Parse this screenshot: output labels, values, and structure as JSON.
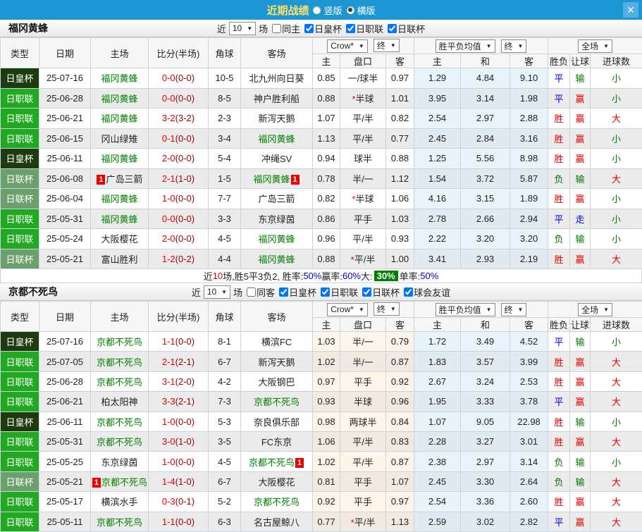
{
  "topbar": {
    "title": "近期战绩",
    "close_glyph": "✕",
    "radios": [
      {
        "label": "竖版",
        "selected": false
      },
      {
        "label": "横版",
        "selected": true
      }
    ]
  },
  "colors": {
    "topbar": "#1d96d4",
    "close_button": "#54aee3",
    "title_text": "#ffe26a",
    "score": "#e60000",
    "halftime": "#990000",
    "focus_team": "#008000",
    "league": {
      "日皇杯": "#1d3b0e",
      "日职联": "#22a922",
      "日联杯": "#6b9f6b"
    },
    "win_red": "#e60000",
    "draw_blue": "#0000e6",
    "lose_green": "#007700",
    "percent_blue": "#0000cc",
    "big_badge_bg": "#008000"
  },
  "columns": [
    "类型",
    "日期",
    "主场",
    "比分(半场)",
    "角球",
    "客场",
    "主",
    "盘口",
    "客",
    "主",
    "和",
    "客",
    "胜负",
    "让球",
    "进球数"
  ],
  "header": {
    "odds_source": "Crow*",
    "final": "终",
    "avg_label": "胜平负均值",
    "scope": "全场",
    "caret": "▼"
  },
  "sections": [
    {
      "team": "福冈黄蜂",
      "filter": {
        "near_label": "近",
        "count": "10",
        "games_label": "场",
        "same_label": "同主",
        "same_checked": false,
        "leagues": [
          {
            "label": "日皇杯",
            "checked": true
          },
          {
            "label": "日职联",
            "checked": true
          },
          {
            "label": "日联杯",
            "checked": true
          }
        ]
      },
      "odds_tint": false,
      "rows": [
        {
          "league": "日皇杯",
          "date": "25-07-16",
          "home": "福冈黄蜂",
          "hf": true,
          "hb": "",
          "score": "0-0",
          "half": "(0-0)",
          "corner": "10-5",
          "away": "北九州向日葵",
          "af": false,
          "ab": "",
          "o1": "0.85",
          "line": "一/球半",
          "star": false,
          "o2": "0.97",
          "a1": "1.29",
          "a2": "4.84",
          "a3": "9.10",
          "res": "平",
          "hcp": "输",
          "goals": "小"
        },
        {
          "league": "日职联",
          "date": "25-06-28",
          "home": "福冈黄蜂",
          "hf": true,
          "hb": "",
          "score": "0-0",
          "half": "(0-0)",
          "corner": "8-5",
          "away": "神户胜利船",
          "af": false,
          "ab": "",
          "o1": "0.88",
          "line": "半球",
          "star": true,
          "o2": "1.01",
          "a1": "3.95",
          "a2": "3.14",
          "a3": "1.98",
          "res": "平",
          "hcp": "赢",
          "goals": "小"
        },
        {
          "league": "日职联",
          "date": "25-06-21",
          "home": "福冈黄蜂",
          "hf": true,
          "hb": "",
          "score": "3-2",
          "half": "(3-2)",
          "corner": "2-3",
          "away": "新泻天鹅",
          "af": false,
          "ab": "",
          "o1": "1.07",
          "line": "平/半",
          "star": false,
          "o2": "0.82",
          "a1": "2.54",
          "a2": "2.97",
          "a3": "2.88",
          "res": "胜",
          "hcp": "赢",
          "goals": "大"
        },
        {
          "league": "日职联",
          "date": "25-06-15",
          "home": "冈山绿雉",
          "hf": false,
          "hb": "",
          "score": "0-1",
          "half": "(0-0)",
          "corner": "3-4",
          "away": "福冈黄蜂",
          "af": true,
          "ab": "",
          "o1": "1.13",
          "line": "平/半",
          "star": false,
          "o2": "0.77",
          "a1": "2.45",
          "a2": "2.84",
          "a3": "3.16",
          "res": "胜",
          "hcp": "赢",
          "goals": "小"
        },
        {
          "league": "日皇杯",
          "date": "25-06-11",
          "home": "福冈黄蜂",
          "hf": true,
          "hb": "",
          "score": "2-0",
          "half": "(0-0)",
          "corner": "5-4",
          "away": "冲绳SV",
          "af": false,
          "ab": "",
          "o1": "0.94",
          "line": "球半",
          "star": false,
          "o2": "0.88",
          "a1": "1.25",
          "a2": "5.56",
          "a3": "8.98",
          "res": "胜",
          "hcp": "赢",
          "goals": "小"
        },
        {
          "league": "日联杯",
          "date": "25-06-08",
          "home": "广岛三箭",
          "hf": false,
          "hb": "1",
          "score": "2-1",
          "half": "(1-0)",
          "corner": "1-5",
          "away": "福冈黄蜂",
          "af": true,
          "ab": "1",
          "o1": "0.78",
          "line": "半/一",
          "star": false,
          "o2": "1.12",
          "a1": "1.54",
          "a2": "3.72",
          "a3": "5.87",
          "res": "负",
          "hcp": "输",
          "goals": "大"
        },
        {
          "league": "日联杯",
          "date": "25-06-04",
          "home": "福冈黄蜂",
          "hf": true,
          "hb": "",
          "score": "1-0",
          "half": "(0-0)",
          "corner": "7-7",
          "away": "广岛三箭",
          "af": false,
          "ab": "",
          "o1": "0.82",
          "line": "半球",
          "star": true,
          "o2": "1.06",
          "a1": "4.16",
          "a2": "3.15",
          "a3": "1.89",
          "res": "胜",
          "hcp": "赢",
          "goals": "小"
        },
        {
          "league": "日职联",
          "date": "25-05-31",
          "home": "福冈黄蜂",
          "hf": true,
          "hb": "",
          "score": "0-0",
          "half": "(0-0)",
          "corner": "3-3",
          "away": "东京绿茵",
          "af": false,
          "ab": "",
          "o1": "0.86",
          "line": "平手",
          "star": false,
          "o2": "1.03",
          "a1": "2.78",
          "a2": "2.66",
          "a3": "2.94",
          "res": "平",
          "hcp": "走",
          "goals": "小"
        },
        {
          "league": "日职联",
          "date": "25-05-24",
          "home": "大阪樱花",
          "hf": false,
          "hb": "",
          "score": "2-0",
          "half": "(0-0)",
          "corner": "4-5",
          "away": "福冈黄蜂",
          "af": true,
          "ab": "",
          "o1": "0.96",
          "line": "平/半",
          "star": false,
          "o2": "0.93",
          "a1": "2.22",
          "a2": "3.20",
          "a3": "3.20",
          "res": "负",
          "hcp": "输",
          "goals": "小"
        },
        {
          "league": "日联杯",
          "date": "25-05-21",
          "home": "富山胜利",
          "hf": false,
          "hb": "",
          "score": "1-2",
          "half": "(0-2)",
          "corner": "4-4",
          "away": "福冈黄蜂",
          "af": true,
          "ab": "",
          "o1": "0.88",
          "line": "平/半",
          "star": true,
          "o2": "1.00",
          "a1": "3.41",
          "a2": "2.93",
          "a3": "2.19",
          "res": "胜",
          "hcp": "赢",
          "goals": "大"
        }
      ],
      "summary": [
        {
          "text": "近"
        },
        {
          "text": "10",
          "color": "red"
        },
        {
          "text": "场,胜5平3负2, 胜率:"
        },
        {
          "text": "50%",
          "color": "blue"
        },
        {
          "text": " 赢率:"
        },
        {
          "text": "60%",
          "color": "blue"
        },
        {
          "text": " 大: "
        },
        {
          "text": "30%",
          "color": "badge"
        },
        {
          "text": " 单率:"
        },
        {
          "text": "50%",
          "color": "blue"
        }
      ]
    },
    {
      "team": "京都不死鸟",
      "filter": {
        "near_label": "近",
        "count": "10",
        "games_label": "场",
        "same_label": "同客",
        "same_checked": false,
        "leagues": [
          {
            "label": "日皇杯",
            "checked": true
          },
          {
            "label": "日职联",
            "checked": true
          },
          {
            "label": "日联杯",
            "checked": true
          },
          {
            "label": "球会友谊",
            "checked": true
          }
        ]
      },
      "odds_tint": true,
      "rows": [
        {
          "league": "日皇杯",
          "date": "25-07-16",
          "home": "京都不死鸟",
          "hf": true,
          "hb": "",
          "score": "1-1",
          "half": "(0-0)",
          "corner": "8-1",
          "away": "横滨FC",
          "af": false,
          "ab": "",
          "o1": "1.03",
          "line": "半/一",
          "star": false,
          "o2": "0.79",
          "a1": "1.72",
          "a2": "3.49",
          "a3": "4.52",
          "res": "平",
          "hcp": "输",
          "goals": "小"
        },
        {
          "league": "日职联",
          "date": "25-07-05",
          "home": "京都不死鸟",
          "hf": true,
          "hb": "",
          "score": "2-1",
          "half": "(2-1)",
          "corner": "6-7",
          "away": "新泻天鹅",
          "af": false,
          "ab": "",
          "o1": "1.02",
          "line": "半/一",
          "star": false,
          "o2": "0.87",
          "a1": "1.83",
          "a2": "3.57",
          "a3": "3.99",
          "res": "胜",
          "hcp": "赢",
          "goals": "大"
        },
        {
          "league": "日职联",
          "date": "25-06-28",
          "home": "京都不死鸟",
          "hf": true,
          "hb": "",
          "score": "3-1",
          "half": "(2-0)",
          "corner": "4-2",
          "away": "大阪钢巴",
          "af": false,
          "ab": "",
          "o1": "0.97",
          "line": "平手",
          "star": false,
          "o2": "0.92",
          "a1": "2.67",
          "a2": "3.24",
          "a3": "2.53",
          "res": "胜",
          "hcp": "赢",
          "goals": "大"
        },
        {
          "league": "日职联",
          "date": "25-06-21",
          "home": "柏太阳神",
          "hf": false,
          "hb": "",
          "score": "3-3",
          "half": "(2-1)",
          "corner": "7-3",
          "away": "京都不死鸟",
          "af": true,
          "ab": "",
          "o1": "0.93",
          "line": "半球",
          "star": false,
          "o2": "0.96",
          "a1": "1.95",
          "a2": "3.33",
          "a3": "3.78",
          "res": "平",
          "hcp": "赢",
          "goals": "大"
        },
        {
          "league": "日皇杯",
          "date": "25-06-11",
          "home": "京都不死鸟",
          "hf": true,
          "hb": "",
          "score": "1-0",
          "half": "(0-0)",
          "corner": "5-3",
          "away": "奈良俱乐部",
          "af": false,
          "ab": "",
          "o1": "0.98",
          "line": "两球半",
          "star": false,
          "o2": "0.84",
          "a1": "1.07",
          "a2": "9.05",
          "a3": "22.98",
          "res": "胜",
          "hcp": "输",
          "goals": "小"
        },
        {
          "league": "日职联",
          "date": "25-05-31",
          "home": "京都不死鸟",
          "hf": true,
          "hb": "",
          "score": "3-0",
          "half": "(1-0)",
          "corner": "3-5",
          "away": "FC东京",
          "af": false,
          "ab": "",
          "o1": "1.06",
          "line": "平/半",
          "star": false,
          "o2": "0.83",
          "a1": "2.28",
          "a2": "3.27",
          "a3": "3.01",
          "res": "胜",
          "hcp": "赢",
          "goals": "大"
        },
        {
          "league": "日职联",
          "date": "25-05-25",
          "home": "东京绿茵",
          "hf": false,
          "hb": "",
          "score": "1-0",
          "half": "(0-0)",
          "corner": "4-5",
          "away": "京都不死鸟",
          "af": true,
          "ab": "1",
          "o1": "1.02",
          "line": "平/半",
          "star": false,
          "o2": "0.87",
          "a1": "2.38",
          "a2": "2.97",
          "a3": "3.14",
          "res": "负",
          "hcp": "输",
          "goals": "小"
        },
        {
          "league": "日联杯",
          "date": "25-05-21",
          "home": "京都不死鸟",
          "hf": true,
          "hb": "1",
          "score": "1-4",
          "half": "(1-0)",
          "corner": "6-7",
          "away": "大阪樱花",
          "af": false,
          "ab": "",
          "o1": "0.81",
          "line": "平手",
          "star": false,
          "o2": "1.07",
          "a1": "2.45",
          "a2": "3.30",
          "a3": "2.64",
          "res": "负",
          "hcp": "输",
          "goals": "大"
        },
        {
          "league": "日职联",
          "date": "25-05-17",
          "home": "横滨水手",
          "hf": false,
          "hb": "",
          "score": "0-3",
          "half": "(0-1)",
          "corner": "5-2",
          "away": "京都不死鸟",
          "af": true,
          "ab": "",
          "o1": "0.92",
          "line": "平手",
          "star": false,
          "o2": "0.97",
          "a1": "2.54",
          "a2": "3.36",
          "a3": "2.60",
          "res": "胜",
          "hcp": "赢",
          "goals": "大"
        },
        {
          "league": "日职联",
          "date": "25-05-11",
          "home": "京都不死鸟",
          "hf": true,
          "hb": "",
          "score": "1-1",
          "half": "(0-0)",
          "corner": "6-3",
          "away": "名古屋鲸八",
          "af": false,
          "ab": "",
          "o1": "0.77",
          "line": "平/半",
          "star": true,
          "o2": "1.13",
          "a1": "2.59",
          "a2": "3.02",
          "a3": "2.82",
          "res": "平",
          "hcp": "赢",
          "goals": "大"
        }
      ],
      "summary": null
    }
  ]
}
